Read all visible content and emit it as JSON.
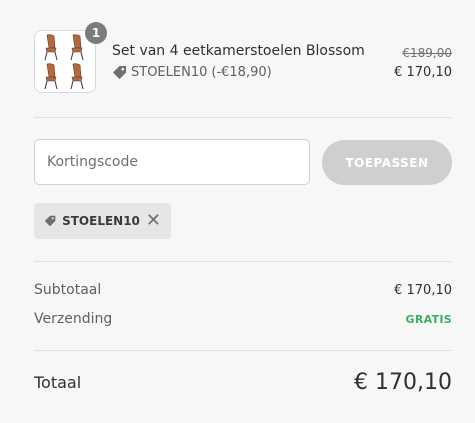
{
  "product": {
    "image": "dining-chairs-set-image",
    "quantity": "1",
    "title": "Set van 4 eetkamerstoelen Blossom",
    "discount_code": "STOELEN10",
    "discount_amount": "(-€18,90)",
    "original_price": "€189,00",
    "price": "€ 170,10"
  },
  "coupon": {
    "placeholder": "Kortingscode",
    "value": "",
    "apply_label": "TOEPASSEN",
    "applied_tag": "STOELEN10"
  },
  "summary": {
    "subtotal_label": "Subtotaal",
    "subtotal_value": "€ 170,10",
    "shipping_label": "Verzending",
    "shipping_value": "GRATIS",
    "total_label": "Totaal",
    "total_value": "€ 170,10"
  },
  "colors": {
    "background": "#f7f7f7",
    "free_shipping": "#3fae63",
    "apply_button_disabled": "#cfcfcf",
    "tag_background": "#e6e6e6"
  }
}
